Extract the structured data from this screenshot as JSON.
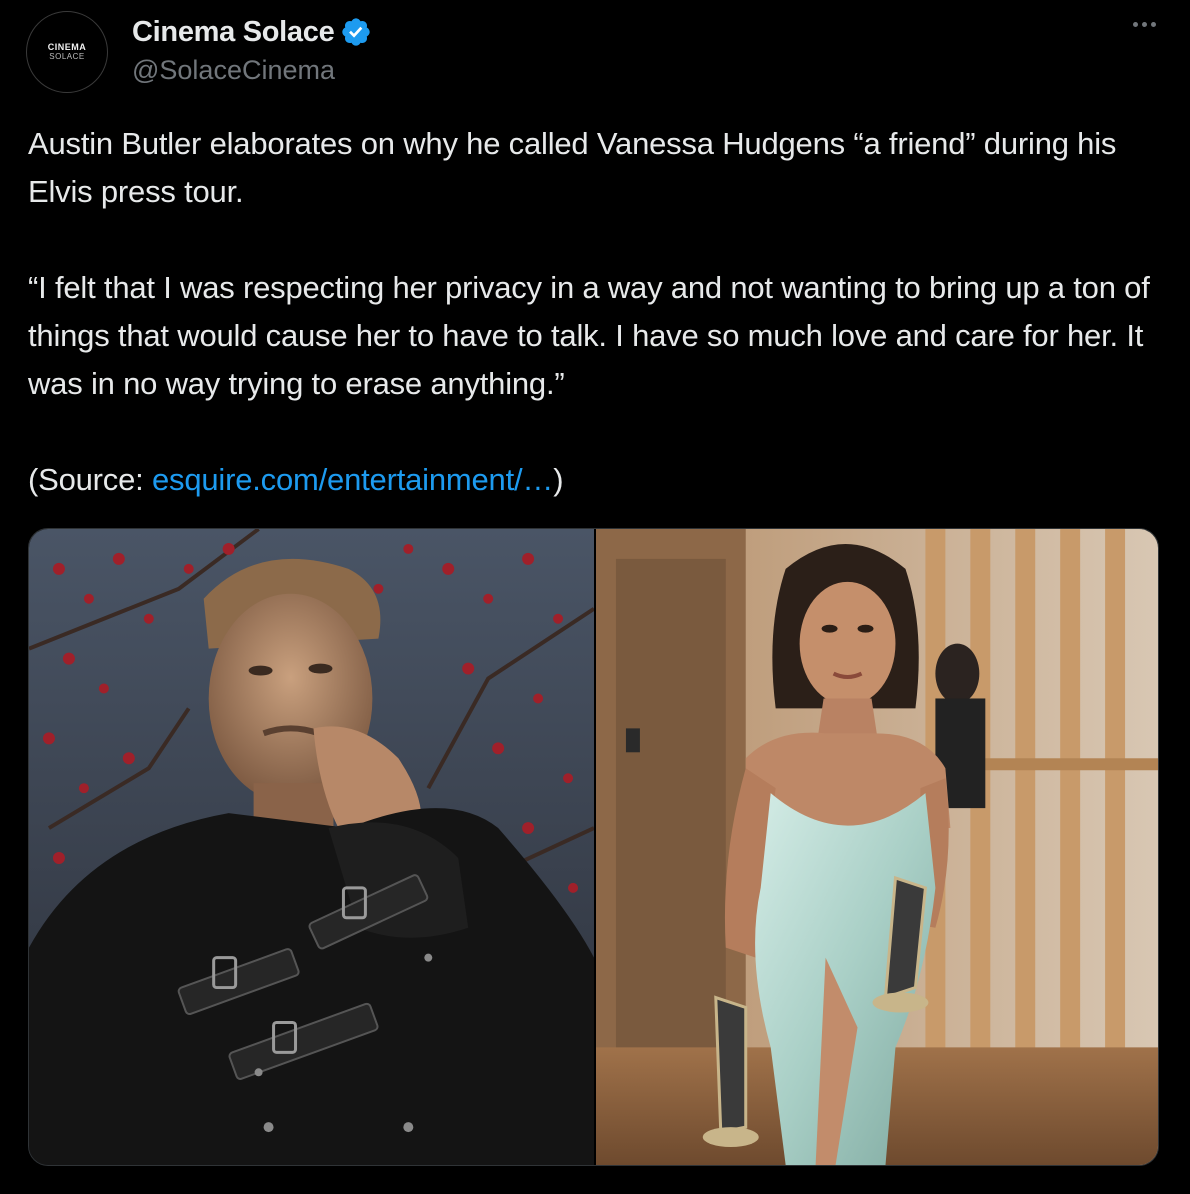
{
  "author": {
    "avatar_line1": "CINEMA",
    "avatar_line2": "SOLACE",
    "display_name": "Cinema Solace",
    "handle": "@SolaceCinema",
    "verified": true
  },
  "icons": {
    "verified": "verified-badge-icon",
    "more": "more-options-icon"
  },
  "tweet": {
    "paragraph1": "Austin Butler elaborates on why he called Vanessa Hudgens “a friend” during his Elvis press tour.",
    "paragraph2": "“I felt that I was respecting her privacy in a way and not wanting to bring up a ton of things that would cause her to have to talk. I have so much love and care for her. It was in no way trying to erase anything.”",
    "source_prefix": "(Source: ",
    "source_link": "esquire.com/entertainment/…",
    "source_suffix": ")"
  },
  "colors": {
    "background": "#000000",
    "text": "#e7e9ea",
    "secondary": "#71767b",
    "link": "#1d9bf0",
    "verified": "#1d9bf0"
  }
}
